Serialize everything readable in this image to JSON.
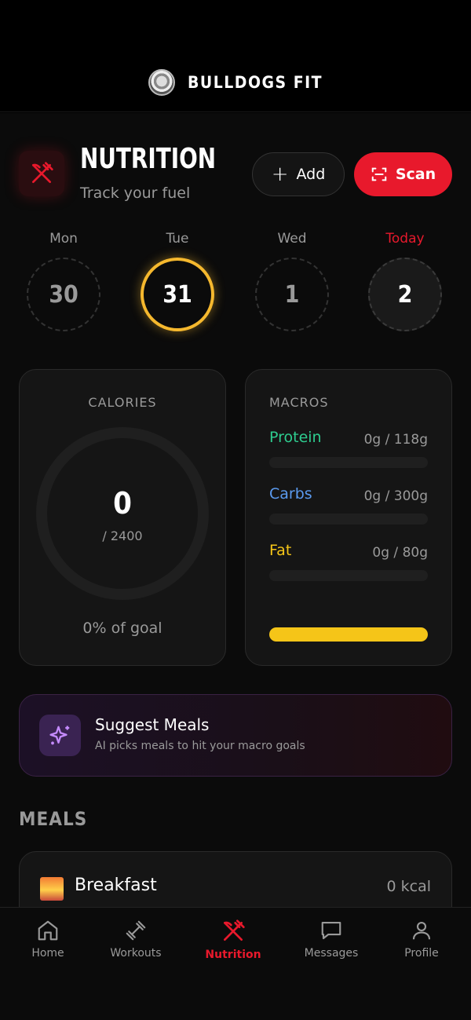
{
  "brand": {
    "name": "BULLDOGS FIT"
  },
  "header": {
    "title": "NUTRITION",
    "subtitle": "Track your fuel",
    "add_label": "Add",
    "scan_label": "Scan"
  },
  "days": [
    {
      "label": "Mon",
      "date": "30",
      "state": "past"
    },
    {
      "label": "Tue",
      "date": "31",
      "state": "selected"
    },
    {
      "label": "Wed",
      "date": "1",
      "state": "past"
    },
    {
      "label": "Today",
      "date": "2",
      "state": "today"
    }
  ],
  "calories": {
    "label": "CALORIES",
    "value": "0",
    "goal": "/ 2400",
    "percent_text": "0% of goal",
    "progress": 0
  },
  "macros": {
    "label": "MACROS",
    "items": [
      {
        "name": "Protein",
        "amount": "0g / 118g",
        "color": "#2ecc8f",
        "progress": 0
      },
      {
        "name": "Carbs",
        "amount": "0g / 300g",
        "color": "#5b9bf0",
        "progress": 0
      },
      {
        "name": "Fat",
        "amount": "0g / 80g",
        "color": "#f5c518",
        "progress": 0
      }
    ]
  },
  "suggest": {
    "title": "Suggest Meals",
    "subtitle": "AI picks meals to hit your macro goals"
  },
  "meals": {
    "title": "MEALS",
    "items": [
      {
        "name": "Breakfast",
        "kcal": "0 kcal",
        "icon": "sunrise-icon"
      }
    ]
  },
  "nav": {
    "items": [
      {
        "label": "Home",
        "icon": "home-icon"
      },
      {
        "label": "Workouts",
        "icon": "dumbbell-icon"
      },
      {
        "label": "Nutrition",
        "icon": "fork-knife-icon",
        "active": true
      },
      {
        "label": "Messages",
        "icon": "chat-icon"
      },
      {
        "label": "Profile",
        "icon": "person-icon"
      }
    ]
  },
  "colors": {
    "accent": "#e8192c",
    "selected_ring": "#f5b82e",
    "fat": "#f5c518",
    "protein": "#2ecc8f",
    "carbs": "#5b9bf0"
  }
}
